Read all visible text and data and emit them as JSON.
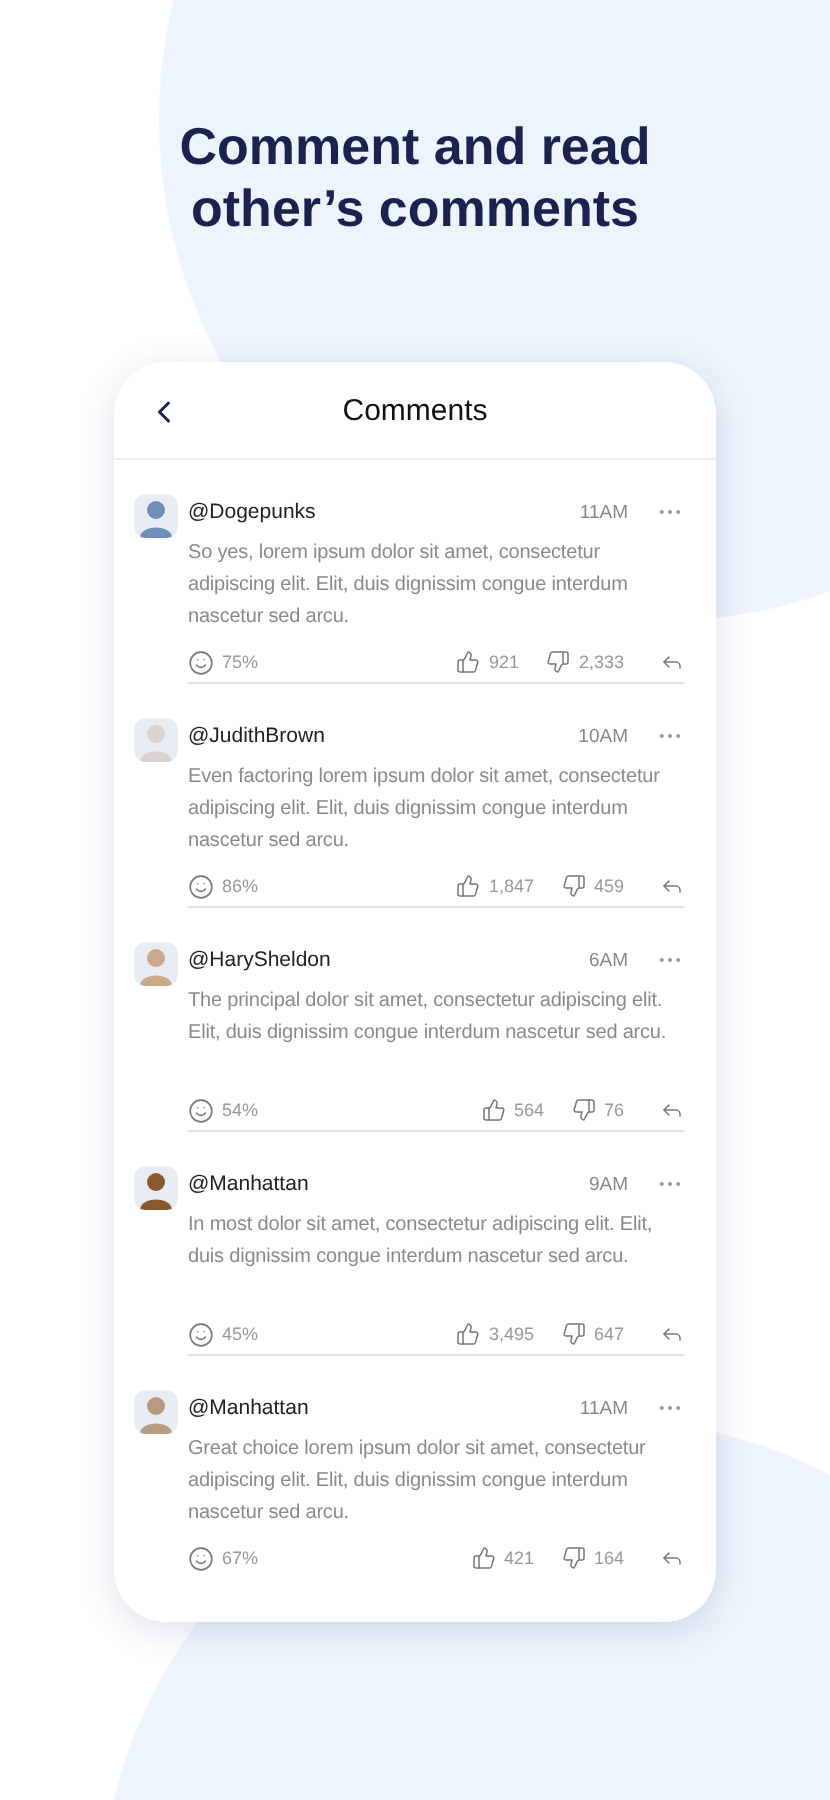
{
  "headline": "Comment and read other’s comments",
  "screen": {
    "title": "Comments"
  },
  "comments": [
    {
      "user": "@Dogepunks",
      "time": "11AM",
      "text": "So yes, lorem ipsum dolor sit amet, consectetur adipiscing elit. Elit, duis dignissim congue interdum nascetur sed arcu.",
      "score": "75%",
      "likes": "921",
      "dislikes": "2,333"
    },
    {
      "user": "@JudithBrown",
      "time": "10AM",
      "text": "Even factoring lorem ipsum dolor sit amet, consectetur adipiscing elit. Elit, duis dignissim congue interdum nascetur sed arcu.",
      "score": "86%",
      "likes": "1,847",
      "dislikes": "459"
    },
    {
      "user": "@HarySheldon",
      "time": "6AM",
      "text": "The principal dolor sit amet, consectetur adipiscing elit. Elit, duis dignissim congue interdum nascetur sed arcu.",
      "score": "54%",
      "likes": "564",
      "dislikes": "76"
    },
    {
      "user": "@Manhattan",
      "time": "9AM",
      "text": "In most dolor sit amet, consectetur adipiscing elit. Elit, duis dignissim congue interdum nascetur sed arcu.",
      "score": "45%",
      "likes": "3,495",
      "dislikes": "647"
    },
    {
      "user": "@Manhattan",
      "time": "11AM",
      "text": "Great choice lorem ipsum dolor sit amet, consectetur adipiscing elit. Elit, duis dignissim congue interdum nascetur sed arcu.",
      "score": "67%",
      "likes": "421",
      "dislikes": "164"
    }
  ]
}
